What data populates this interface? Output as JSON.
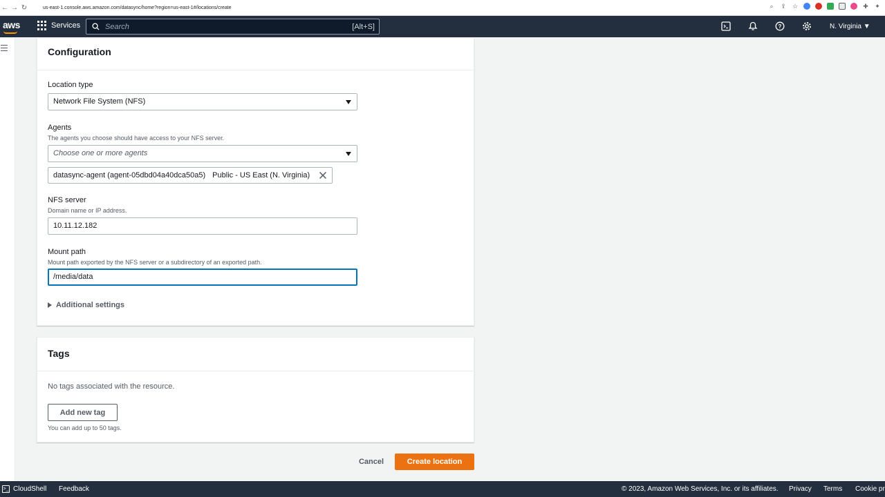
{
  "browser": {
    "url": "us-east-1.console.aws.amazon.com/datasync/home?region=us-east-1#/locations/create"
  },
  "header": {
    "logo": "aws",
    "services_label": "Services",
    "search_placeholder": "Search",
    "search_shortcut": "[Alt+S]",
    "region": "N. Virginia ▼"
  },
  "configuration": {
    "title": "Configuration",
    "location_type": {
      "label": "Location type",
      "value": "Network File System (NFS)"
    },
    "agents": {
      "label": "Agents",
      "description": "The agents you choose should have access to your NFS server.",
      "placeholder": "Choose one or more agents",
      "selected": {
        "name": "datasync-agent (agent-05dbd04a40dca50a5)",
        "endpoint": "Public - US East (N. Virginia)"
      }
    },
    "nfs_server": {
      "label": "NFS server",
      "description": "Domain name or IP address.",
      "value": "10.11.12.182"
    },
    "mount_path": {
      "label": "Mount path",
      "description": "Mount path exported by the NFS server or a subdirectory of an exported path.",
      "value": "/media/data"
    },
    "additional_settings": "Additional settings"
  },
  "tags": {
    "title": "Tags",
    "empty_text": "No tags associated with the resource.",
    "add_button": "Add new tag",
    "hint": "You can add up to 50 tags."
  },
  "actions": {
    "cancel": "Cancel",
    "create": "Create location"
  },
  "footer": {
    "cloudshell": "CloudShell",
    "feedback": "Feedback",
    "copyright": "© 2023, Amazon Web Services, Inc. or its affiliates.",
    "privacy": "Privacy",
    "terms": "Terms",
    "cookie": "Cookie pr"
  },
  "colors": {
    "header_bg": "#232f3e",
    "primary": "#ec7211",
    "focus": "#0073bb"
  }
}
